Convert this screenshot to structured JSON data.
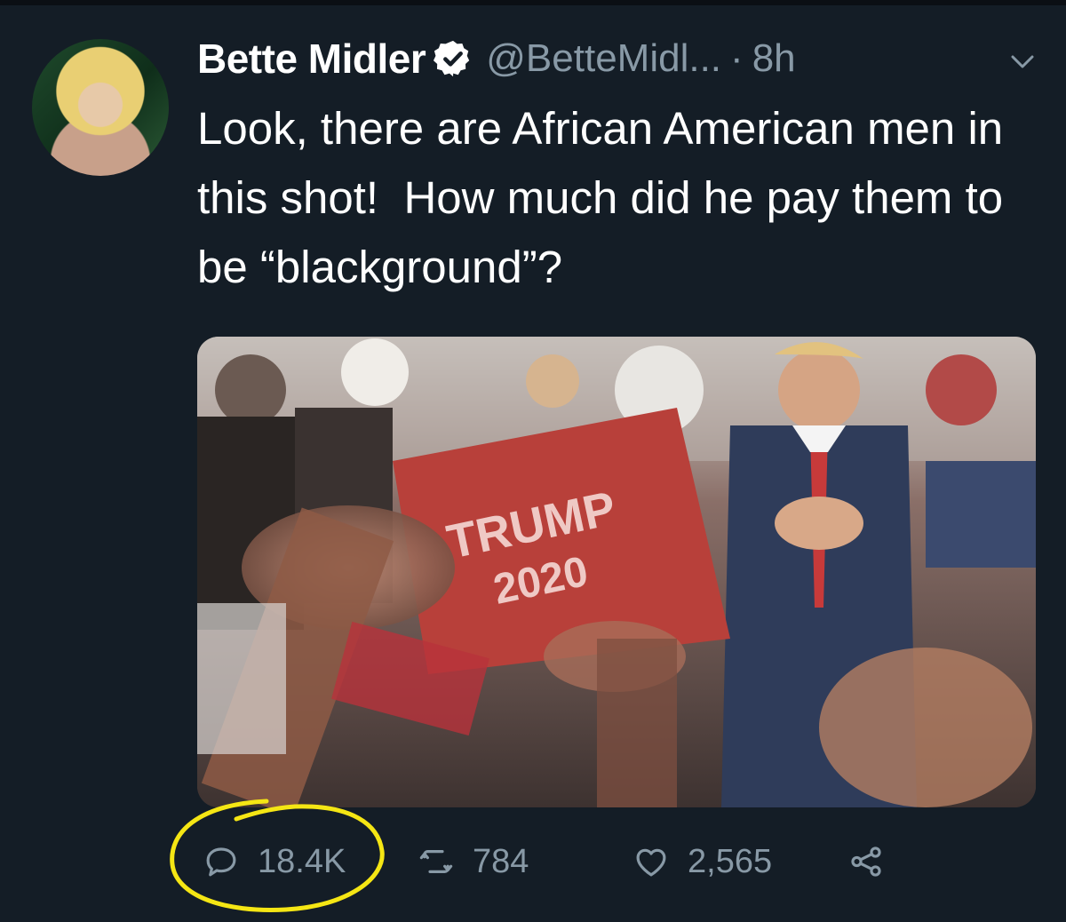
{
  "tweet": {
    "author_name": "Bette Midler",
    "handle": "@BetteMidl...",
    "separator": "·",
    "time": "8h",
    "text": "Look, there are African American men in this shot!  How much did he pay them to be “blackground”?",
    "photo_sign_text_line1": "TRUMP",
    "photo_sign_text_line2": "2020"
  },
  "actions": {
    "replies": "18.4K",
    "retweets": "784",
    "likes": "2,565"
  },
  "colors": {
    "background": "#141d26",
    "text_primary": "#ffffff",
    "text_secondary": "#8899a6",
    "verified_badge": "#ffffff",
    "highlight_circle": "#f5e614"
  },
  "icons": {
    "verified": "verified-badge-icon",
    "caret": "chevron-down-icon",
    "reply": "reply-icon",
    "retweet": "retweet-icon",
    "like": "heart-icon",
    "share": "share-icon"
  }
}
